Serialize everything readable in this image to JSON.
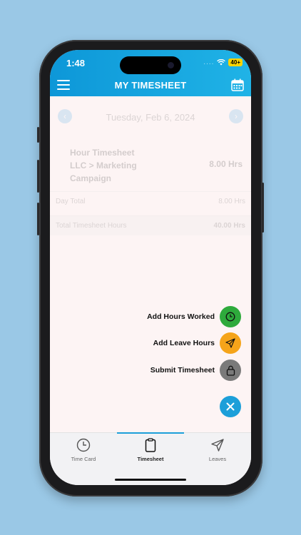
{
  "status_bar": {
    "time": "1:48",
    "dots": "....",
    "battery": "40+"
  },
  "header": {
    "title": "MY TIMESHEET"
  },
  "content": {
    "date": "Tuesday, Feb 6, 2024",
    "entry": {
      "name": "Hour Timesheet LLC > Marketing Campaign",
      "hours": "8.00 Hrs"
    },
    "day_total": {
      "label": "Day Total",
      "value": "8.00 Hrs"
    },
    "timesheet_total": {
      "label": "Total Timesheet Hours",
      "value": "40.00 Hrs"
    }
  },
  "fab_actions": [
    {
      "label": "Add Hours Worked",
      "color": "#2eaa3c",
      "icon": "clock-icon"
    },
    {
      "label": "Add Leave Hours",
      "color": "#f5a41a",
      "icon": "send-icon"
    },
    {
      "label": "Submit Timesheet",
      "color": "#7a7a7a",
      "icon": "lock-icon"
    }
  ],
  "tabs": [
    {
      "label": "Time Card",
      "icon": "clock-icon"
    },
    {
      "label": "Timesheet",
      "icon": "clipboard-icon",
      "active": true
    },
    {
      "label": "Leaves",
      "icon": "send-icon"
    }
  ],
  "colors": {
    "accent": "#1c9fd9",
    "header_start": "#0d97d8",
    "header_end": "#20b3e6"
  }
}
